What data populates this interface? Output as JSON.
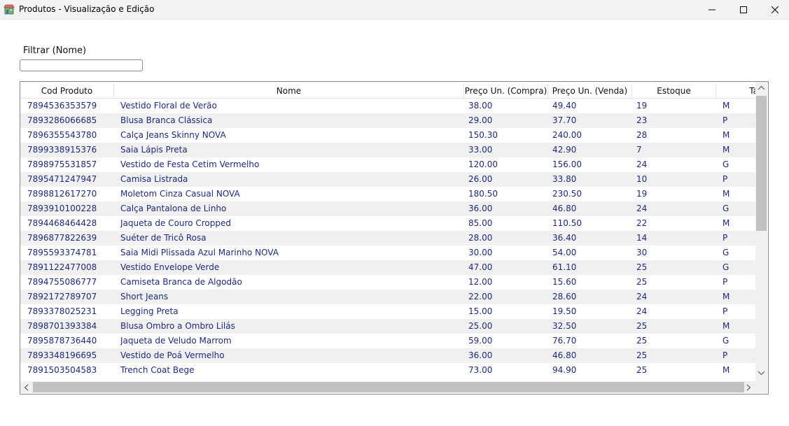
{
  "window": {
    "title": "Produtos - Visualização e Edição",
    "icon": "store-icon"
  },
  "filter": {
    "label": "Filtrar (Nome)",
    "value": "",
    "placeholder": ""
  },
  "table": {
    "columns": [
      "Cod Produto",
      "Nome",
      "Preço Un. (Compra)",
      "Preço Un. (Venda)",
      "Estoque",
      "Tam"
    ],
    "rows": [
      [
        "7894536353579",
        "Vestido Floral de Verão",
        "38.00",
        "49.40",
        "19",
        "M"
      ],
      [
        "7893286066685",
        "Blusa Branca Clássica",
        "29.00",
        "37.70",
        "23",
        "P"
      ],
      [
        "7896355543780",
        "Calça Jeans Skinny NOVA",
        "150.30",
        "240.00",
        "28",
        "M"
      ],
      [
        "7899338915376",
        "Saia Lápis Preta",
        "33.00",
        "42.90",
        "7",
        "M"
      ],
      [
        "7898975531857",
        "Vestido de Festa Cetim Vermelho",
        "120.00",
        "156.00",
        "24",
        "G"
      ],
      [
        "7895471247947",
        "Camisa Listrada",
        "26.00",
        "33.80",
        "10",
        "P"
      ],
      [
        "7898812617270",
        "Moletom Cinza Casual NOVA",
        "180.50",
        "230.50",
        "19",
        "M"
      ],
      [
        "7893910100228",
        "Calça Pantalona de Linho",
        "36.00",
        "46.80",
        "24",
        "G"
      ],
      [
        "7894468464428",
        "Jaqueta de Couro Cropped",
        "85.00",
        "110.50",
        "22",
        "M"
      ],
      [
        "7896877822639",
        "Suéter de Tricô Rosa",
        "28.00",
        "36.40",
        "14",
        "P"
      ],
      [
        "7895593374781",
        "Saia Midi Plissada Azul Marinho NOVA",
        "30.00",
        "54.00",
        "30",
        "G"
      ],
      [
        "7891122477008",
        "Vestido Envelope Verde",
        "47.00",
        "61.10",
        "25",
        "G"
      ],
      [
        "7894755086777",
        "Camiseta Branca de Algodão",
        "12.00",
        "15.60",
        "25",
        "P"
      ],
      [
        "7892172789707",
        "Short Jeans",
        "22.00",
        "28.60",
        "24",
        "M"
      ],
      [
        "7893378025231",
        "Legging Preta",
        "15.00",
        "19.50",
        "24",
        "P"
      ],
      [
        "7898701393384",
        "Blusa Ombro a Ombro Lilás",
        "25.00",
        "32.50",
        "25",
        "M"
      ],
      [
        "7895878736440",
        "Jaqueta de Veludo Marrom",
        "59.00",
        "76.70",
        "25",
        "G"
      ],
      [
        "7893348196695",
        "Vestido de Poá Vermelho",
        "36.00",
        "46.80",
        "25",
        "P"
      ],
      [
        "7891503504583",
        "Trench Coat Bege",
        "73.00",
        "94.90",
        "25",
        "M"
      ]
    ]
  },
  "colors": {
    "cell_text": "#1e2a7a",
    "row_alt": "#f0f0f0",
    "scroll_thumb": "#c1c1c1"
  }
}
